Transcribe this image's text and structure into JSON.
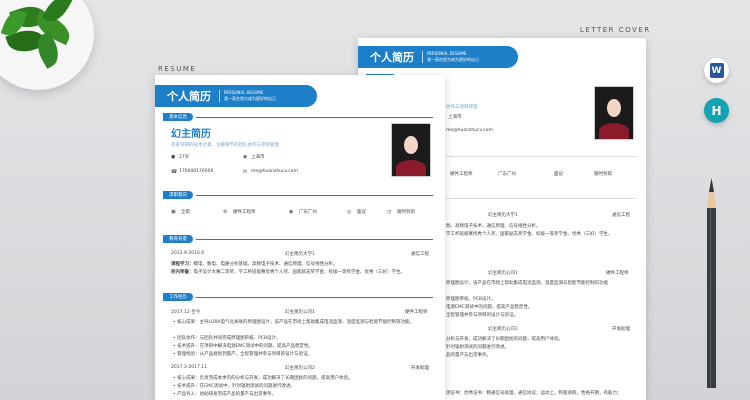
{
  "labels": {
    "resume": "RESUME",
    "cover": "LETTER COVER"
  },
  "icons": {
    "word_letter": "W",
    "other_letter": "H"
  },
  "colors": {
    "accent": "#1e7fc9",
    "background": "#d9dbde"
  },
  "front": {
    "title": "个人简历",
    "subtitle_en": "PERSONAL RESUME",
    "subtitle_cn": "我一直在努力成为更好的自己",
    "sections": {
      "basic": "基本信息",
      "intent": "求职意向",
      "education": "教育背景",
      "work": "工作经历"
    },
    "name": "幻主简历",
    "slogan": "热爱深耕的技术达者，注重细节的团队协作与项目管理",
    "info": {
      "age": "27岁",
      "city": "上海市",
      "phone": "176000176000",
      "email": "me@huanzhucv.com"
    },
    "intent": {
      "type": "全职",
      "job": "硬件工程师",
      "place": "广东广州",
      "salary": "面议",
      "start": "随时到岗"
    },
    "edu": {
      "period": "2012.9-2016.6",
      "school": "幻主简历大学1",
      "major": "通信工程",
      "courses_label": "课程学习：",
      "courses": "模电、数电、电路分析基础、高频电子技术、通信原理、信号线性分析。",
      "awards_label": "校内荣誉：",
      "awards": "电子设计大赛二等奖、学工杯班级赛优秀个人奖、国家励志奖学金、校级一等奖学金、优秀（三好）学生。"
    },
    "work1": {
      "period": "2017.12-至今",
      "company": "幻主简历公司1",
      "role": "硬件工程师",
      "bullets": [
        "核心成果：主导LORA电气化关联的原理图设计，该产品在市场上帮助集成电流监测、温度监测与智能节能控制等功能。",
        "团队协作：与团队共同完成原理图审核、PCB设计。",
        "技术提升：在项目中解决电源EMC测试中的问题，提高产品稳定性。",
        "管理经验：从产品规划到量产，全程管理并参与项目的设计与验证。"
      ]
    },
    "work2": {
      "period": "2017.3-2017.11",
      "company": "幻主简历公司2",
      "role": "开发助理",
      "bullets": [
        "核心成果：负责完成本季内的分析与开发，成功解决了长期困扰的问题，提高用户体验。",
        "技术提升：在EMC测试中，针对辐射测试的问题进行改进。",
        "产品导入：协助研发完成产品的量产与出货事务。"
      ]
    }
  },
  "back": {
    "title": "个人简历",
    "subtitle_en": "PERSONAL RESUME",
    "subtitle_cn": "我一直在努力成为更好的自己",
    "tag": "基本信息",
    "slogan_tail": "协作与项目管理",
    "city": "上海市",
    "email": "me@huanzhucv.com",
    "intent": {
      "job": "硬件工程师",
      "place": "广东广州",
      "salary": "面议",
      "start": "随时到岗"
    },
    "edu": {
      "school": "幻主简历大学1",
      "major": "通信工程",
      "courses": "频、高频电子技术、通信原理、信号线性分析。",
      "awards": "学工杯班级赛优秀个人奖、国家励志奖学金、校级一等奖学金、优秀（三好）学生。"
    },
    "work1": {
      "company": "幻主简历公司1",
      "role": "硬件工程师",
      "lines": [
        "原理图设计，该产品在市场上帮助集成电流监测、温度监测与智能节能控制的功能",
        "原理图审核，PCB设计。",
        "电源EMC测试中的问题，提高产品稳定性。",
        "全程管理并参与项目的设计与验证。"
      ]
    },
    "work2": {
      "company": "幻主简历公司2",
      "role": "开发助理",
      "lines": [
        "分析与开发，成功解决了长期困扰的问题，提高用户体验。",
        "针对辐射测试的问题进行改进。",
        "品的量产与出货事务。"
      ]
    },
    "skills": "测证书：优秀证书：精通信号处理、通信协议；运动上，积极进取，性格开朗，有毅力；"
  }
}
